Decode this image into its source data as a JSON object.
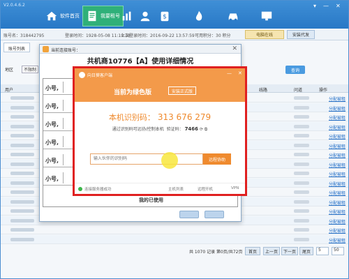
{
  "app": {
    "version": "V2.0.4.6.2"
  },
  "nav": [
    {
      "label": "软件首页",
      "icon": "home-icon"
    },
    {
      "label": "我要租号",
      "icon": "document-icon",
      "active": true
    },
    {
      "label": "",
      "icon": "chart-icon"
    },
    {
      "label": "",
      "icon": "user-icon"
    },
    {
      "label": "",
      "icon": "money-icon"
    },
    {
      "label": "",
      "icon": "fire-icon"
    },
    {
      "label": "",
      "icon": "car-icon"
    },
    {
      "label": "",
      "icon": "monitor-icon"
    }
  ],
  "info": {
    "account": "账号名：318442795",
    "login": "登录时间：1928-05-08 11:19:18",
    "last_login": "上次登录时间：2016-09-22 13:57:59",
    "points": "可用积分：30 积分",
    "online_btn": "电脑在线",
    "download_btn": "安装代发"
  },
  "tabs": [
    "账号列表",
    "当前连接账号："
  ],
  "filter": {
    "label": "地区",
    "select": "不限制",
    "query_btn": "查询"
  },
  "table": {
    "headers": [
      "用户",
      "线路",
      "问道",
      "操作"
    ],
    "action": "分配被租",
    "rows": 16
  },
  "pager": {
    "text": "共 1070 记录 第0页/共72页",
    "first": "首页",
    "prev": "上一页",
    "next": "下一页",
    "last": "尾页",
    "page": "5",
    "size": "50"
  },
  "detail": {
    "tab_title": "当前连接账号：",
    "heading": "共机商10776【A】使用详细情况",
    "row_label": "小号,",
    "rows": 6,
    "bottom_text": "我的已使用"
  },
  "remote": {
    "app_name": "向日葵客户端",
    "version_text": "当前为绿色版",
    "install_btn": "安装正式版",
    "id_label": "本机识别码：",
    "id_value": "313 676 279",
    "hint": "通过识别码可远协/控制本机",
    "code_label": "验证码：",
    "code_value": "7466",
    "partner_placeholder": "输入伙伴的识别码",
    "remote_btn": "远程协助",
    "footer": [
      "连接服务器成功",
      "主机列表",
      "远程开机",
      "VPN"
    ]
  }
}
